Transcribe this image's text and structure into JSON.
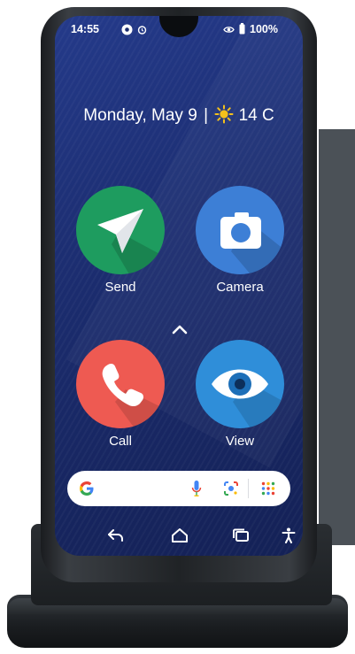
{
  "status_bar": {
    "time": "14:55",
    "battery": "100%",
    "icons": [
      "chrome-icon",
      "alarm-icon",
      "eye-comfort-icon",
      "battery-icon"
    ]
  },
  "date_weather": {
    "date": "Monday, May 9",
    "separator": "|",
    "temperature": "14 C",
    "weather_icon": "sun-icon"
  },
  "apps": [
    {
      "label": "Send",
      "icon": "paper-plane-icon",
      "color": "#1e9c5f"
    },
    {
      "label": "Camera",
      "icon": "camera-icon",
      "color": "#3d7fd6"
    },
    {
      "label": "Call",
      "icon": "phone-icon",
      "color": "#ee5a52"
    },
    {
      "label": "View",
      "icon": "eye-icon",
      "color": "#2f8ed9"
    }
  ],
  "search_bar": {
    "icons": [
      "google-g-icon",
      "microphone-icon",
      "lens-icon",
      "apps-grid-icon"
    ]
  },
  "nav_bar": {
    "icons": [
      "back-icon",
      "home-icon",
      "recents-icon",
      "accessibility-icon"
    ]
  },
  "colors": {
    "screen_bg": "#1b2c6e",
    "send": "#1e9c5f",
    "camera": "#3d7fd6",
    "call": "#ee5a52",
    "view": "#2f8ed9"
  }
}
